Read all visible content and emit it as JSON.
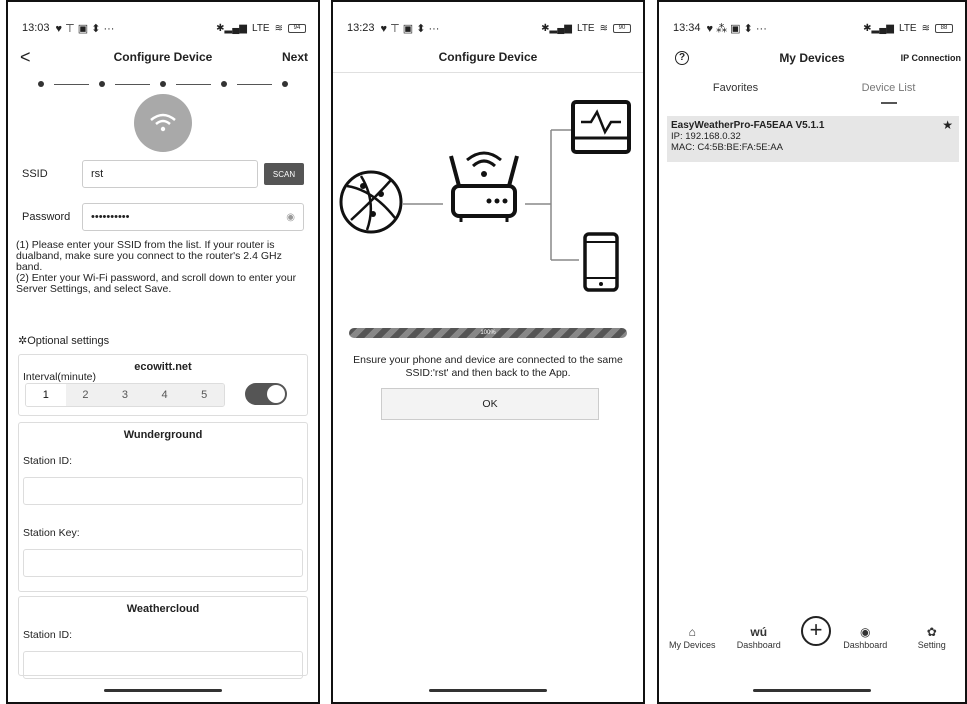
{
  "phone1": {
    "status": {
      "time": "13:03",
      "network": "LTE",
      "battery": "94"
    },
    "nav": {
      "back": "<",
      "title": "Configure Device",
      "next": "Next"
    },
    "ssid": {
      "label": "SSID",
      "value": "rst",
      "scan": "SCAN"
    },
    "password": {
      "label": "Password",
      "value": "••••••••••"
    },
    "instructions": "(1) Please enter your SSID from the list. If your router is dualband, make sure you connect to the router's 2.4 GHz band.\n(2) Enter your Wi-Fi password, and scroll down to enter your Server Settings, and select Save.",
    "optional_title": "Optional settings",
    "ecowitt": {
      "title": "ecowitt.net",
      "interval_label": "Interval(minute)",
      "options": [
        "1",
        "2",
        "3",
        "4",
        "5"
      ],
      "selected": "1",
      "toggle_on": true
    },
    "wunderground": {
      "title": "Wunderground",
      "station_id_label": "Station ID:",
      "station_key_label": "Station Key:"
    },
    "weathercloud": {
      "title": "Weathercloud",
      "station_id_label": "Station ID:"
    }
  },
  "phone2": {
    "status": {
      "time": "13:23",
      "network": "LTE",
      "battery": "90"
    },
    "nav": {
      "title": "Configure Device"
    },
    "progress": {
      "label": "100%",
      "value": 100
    },
    "message": "Ensure your phone and device are connected to the same SSID:'rst' and then back to the App.",
    "ok": "OK"
  },
  "phone3": {
    "status": {
      "time": "13:34",
      "network": "LTE",
      "battery": "88"
    },
    "nav": {
      "title": "My Devices",
      "ip": "IP Connection"
    },
    "tabs": {
      "favorites": "Favorites",
      "device_list": "Device List"
    },
    "device": {
      "name": "EasyWeatherPro-FA5EAA V5.1.1",
      "ip": "IP: 192.168.0.32",
      "mac": "MAC: C4:5B:BE:FA:5E:AA"
    },
    "bottom_nav": [
      {
        "icon": "home-icon",
        "label": "My Devices"
      },
      {
        "icon": "wu-icon",
        "label": "Dashboard"
      },
      {
        "icon": "dashboard-icon",
        "label": "Dashboard"
      },
      {
        "icon": "setting-icon",
        "label": "Setting"
      }
    ],
    "wu_glyph": "wú"
  },
  "colors": {
    "accent": "#555555",
    "card_bg": "#e6e6e6"
  }
}
